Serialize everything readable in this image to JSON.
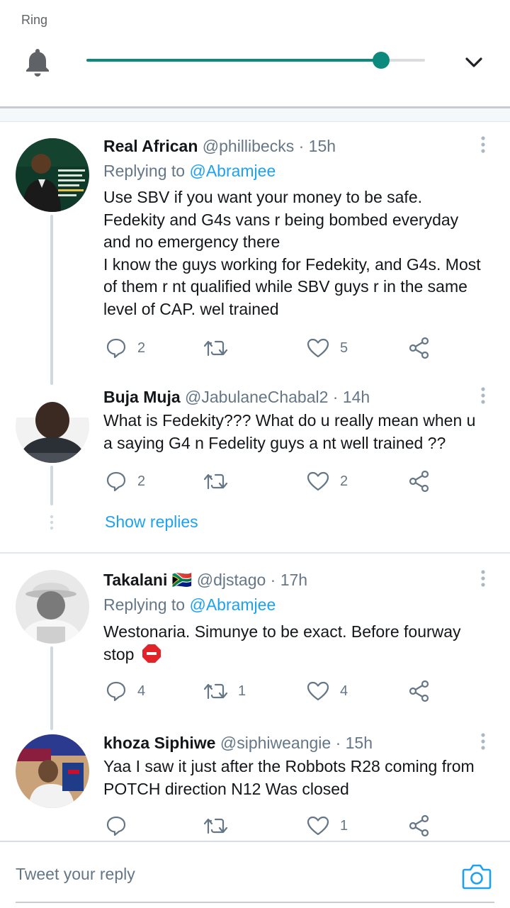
{
  "volume": {
    "label": "Ring",
    "level_percent": 87,
    "icons": {
      "bell": "bell-icon",
      "expand": "chevron-down-icon"
    },
    "accent": "#0d8a7e"
  },
  "tweets": [
    {
      "name": "Real African",
      "handle": "@phillibecks",
      "time": "· 15h",
      "replying_to_label": "Replying to",
      "replying_to_mention": "@Abramjee",
      "text_lines": [
        "Use SBV if you want your money to be safe.",
        "Fedekity and G4s vans r being bombed everyday",
        "and no emergency there",
        "I know the guys working for Fedekity, and G4s. Most",
        "of them r nt qualified while SBV guys r in the same",
        "level of CAP. wel trained"
      ],
      "replies": "2",
      "retweets": "",
      "likes": "5"
    },
    {
      "name": "Buja Muja",
      "handle": "@JabulaneChabal2",
      "time": "· 14h",
      "text_lines": [
        "What is Fedekity??? What do u really mean when u",
        "a saying G4 n Fedelity guys a nt well trained ??"
      ],
      "replies": "2",
      "retweets": "",
      "likes": "2"
    },
    {
      "name": "Takalani",
      "flag": "🇿🇦",
      "handle": "@djstago",
      "time": "· 17h",
      "replying_to_label": "Replying to",
      "replying_to_mention": "@Abramjee",
      "text_lines": [
        "Westonaria. Simunye to be exact. Before fourway",
        "stop"
      ],
      "replies": "4",
      "retweets": "1",
      "likes": "4"
    },
    {
      "name": "khoza Siphiwe",
      "handle": "@siphiweangie",
      "time": "· 15h",
      "text_lines": [
        "Yaa I saw it just after the Robbots R28 coming from",
        "POTCH direction N12 Was closed"
      ],
      "replies": "",
      "retweets": "",
      "likes": "1"
    }
  ],
  "show_replies": "Show replies",
  "reply_bar": {
    "placeholder": "Tweet your reply",
    "camera_icon": "camera-icon"
  },
  "colors": {
    "link": "#1da1f2",
    "secondary_text": "#657786",
    "thread_line": "#cfd9de"
  }
}
